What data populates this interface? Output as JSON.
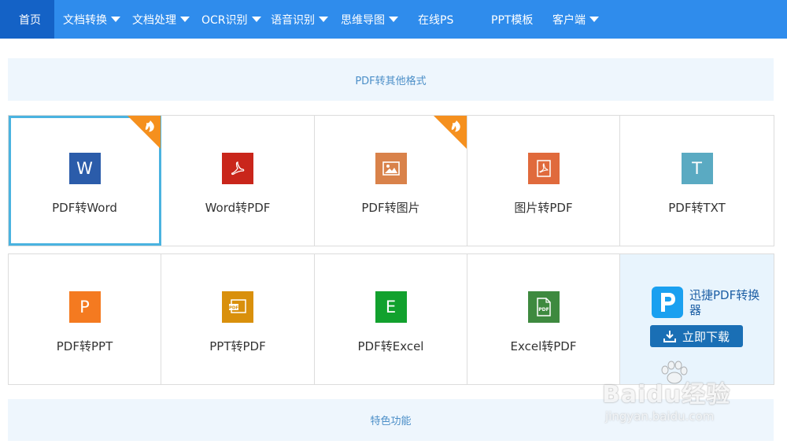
{
  "nav": {
    "items": [
      {
        "label": "首页",
        "has_dropdown": false,
        "active": true
      },
      {
        "label": "文档转换",
        "has_dropdown": true,
        "active": false
      },
      {
        "label": "文档处理",
        "has_dropdown": true,
        "active": false
      },
      {
        "label": "OCR识别",
        "has_dropdown": true,
        "active": false
      },
      {
        "label": "语音识别",
        "has_dropdown": true,
        "active": false
      },
      {
        "label": "思维导图",
        "has_dropdown": true,
        "active": false
      },
      {
        "label": "在线PS",
        "has_dropdown": false,
        "active": false
      },
      {
        "label": "PPT模板",
        "has_dropdown": false,
        "active": false
      },
      {
        "label": "客户端",
        "has_dropdown": true,
        "active": false
      }
    ]
  },
  "sections": {
    "pdf_to_other": "PDF转其他格式",
    "features": "特色功能"
  },
  "tools_row1": [
    {
      "label": "PDF转Word",
      "icon": "word-icon",
      "glyph": "W",
      "color": "#2b5caa",
      "hot": true,
      "selected": true
    },
    {
      "label": "Word转PDF",
      "icon": "pdf-acrobat-icon",
      "glyph": "",
      "color": "#c9261b",
      "hot": false,
      "selected": false
    },
    {
      "label": "PDF转图片",
      "icon": "image-icon",
      "glyph": "",
      "color": "#d9824a",
      "hot": true,
      "selected": false
    },
    {
      "label": "图片转PDF",
      "icon": "pdf-file-icon",
      "glyph": "",
      "color": "#e06a3c",
      "hot": false,
      "selected": false
    },
    {
      "label": "PDF转TXT",
      "icon": "text-icon",
      "glyph": "T",
      "color": "#5aaac2",
      "hot": false,
      "selected": false
    }
  ],
  "tools_row2": [
    {
      "label": "PDF转PPT",
      "icon": "powerpoint-icon",
      "glyph": "P",
      "color": "#f47a20"
    },
    {
      "label": "PPT转PDF",
      "icon": "ppt-pdf-icon",
      "glyph": "",
      "color": "#d9900c"
    },
    {
      "label": "PDF转Excel",
      "icon": "excel-icon",
      "glyph": "E",
      "color": "#12a12e"
    },
    {
      "label": "Excel转PDF",
      "icon": "excel-pdf-icon",
      "glyph": "",
      "color": "#3e8a3f"
    }
  ],
  "promo": {
    "title": "迅捷PDF转换器",
    "button": "立即下载",
    "icon": "xunjie-pdf-logo-icon"
  },
  "watermark": {
    "main": "Baidu经验",
    "sub": "jingyan.baidu.com"
  },
  "colors": {
    "nav_bg": "#2f8cec",
    "nav_active": "#1462c6",
    "band_bg": "#eef6fd",
    "selected_border": "#4ab3e0",
    "hot_ribbon": "#f5901e"
  }
}
